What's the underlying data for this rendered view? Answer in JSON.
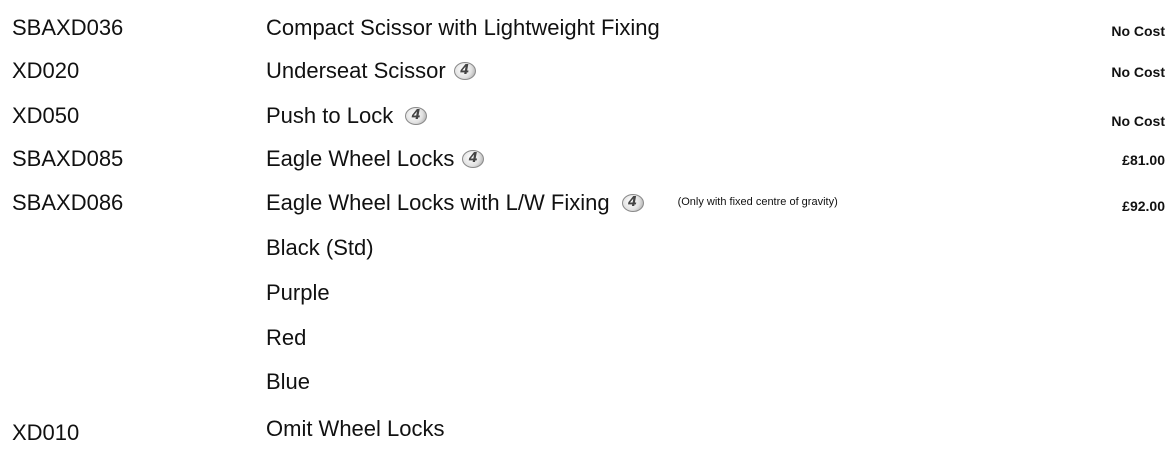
{
  "rows": [
    {
      "code": "SBAXD036",
      "description": "Compact Scissor with Lightweight Fixing",
      "price": "No Cost"
    },
    {
      "code": "XD020",
      "description": "Underseat Scissor",
      "badge": "4",
      "price": "No Cost"
    },
    {
      "code": "XD050",
      "description": "Push to Lock",
      "badge": "4",
      "price": "No Cost"
    },
    {
      "code": "SBAXD085",
      "description": "Eagle Wheel Locks",
      "badge": "4",
      "price": "£81.00"
    },
    {
      "code": "SBAXD086",
      "description": "Eagle Wheel Locks with L/W Fixing",
      "badge": "4",
      "note": "(Only with fixed centre of gravity)",
      "price": "£92.00"
    },
    {
      "description": "Black (Std)"
    },
    {
      "description": "Purple"
    },
    {
      "description": "Red"
    },
    {
      "description": "Blue"
    },
    {
      "code": "XD010",
      "description": "Omit Wheel Locks"
    }
  ]
}
